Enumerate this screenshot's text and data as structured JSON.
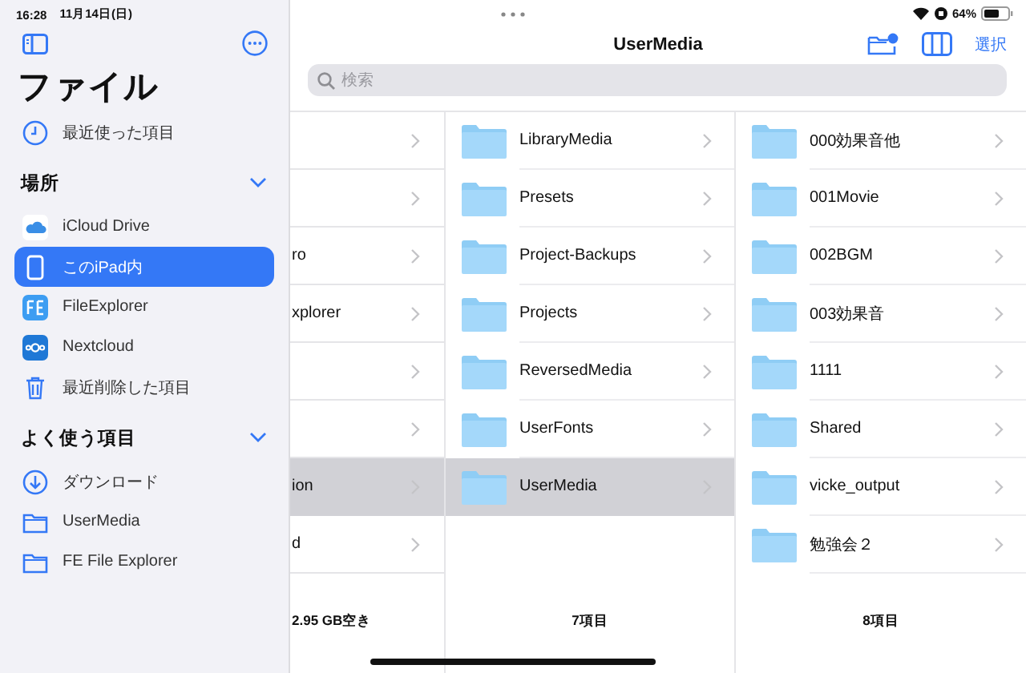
{
  "status_bar": {
    "time": "16:28",
    "date": "11月14日(日)",
    "battery": "64%"
  },
  "sidebar": {
    "title": "ファイル",
    "recents": {
      "label": "最近使った項目"
    },
    "sections": [
      {
        "title": "場所",
        "expanded": true,
        "items": [
          {
            "label": "iCloud Drive",
            "kind": "icloud",
            "selected": false
          },
          {
            "label": "このiPad内",
            "kind": "ipad",
            "selected": true
          },
          {
            "label": "FileExplorer",
            "kind": "fe",
            "selected": false
          },
          {
            "label": "Nextcloud",
            "kind": "nextcloud",
            "selected": false
          },
          {
            "label": "最近削除した項目",
            "kind": "trash",
            "selected": false
          }
        ]
      },
      {
        "title": "よく使う項目",
        "expanded": true,
        "items": [
          {
            "label": "ダウンロード",
            "kind": "download",
            "selected": false
          },
          {
            "label": "UserMedia",
            "kind": "folder",
            "selected": false
          },
          {
            "label": "FE File Explorer",
            "kind": "folder",
            "selected": false
          }
        ]
      }
    ]
  },
  "main": {
    "title": "UserMedia",
    "select_button": "選択",
    "search": {
      "placeholder": "検索"
    },
    "columns": [
      {
        "icons": false,
        "footer": "2.95 GB空き",
        "items": [
          {
            "selected": false
          },
          {
            "selected": false
          },
          {
            "name": "ro",
            "selected": false
          },
          {
            "name": "xplorer",
            "selected": false
          },
          {
            "selected": false
          },
          {
            "selected": false
          },
          {
            "name": "ion",
            "selected": true
          },
          {
            "name": "d",
            "selected": false
          }
        ]
      },
      {
        "icons": true,
        "footer": "7項目",
        "items": [
          {
            "name": "LibraryMedia",
            "selected": false
          },
          {
            "name": "Presets",
            "selected": false
          },
          {
            "name": "Project-Backups",
            "selected": false
          },
          {
            "name": "Projects",
            "selected": false
          },
          {
            "name": "ReversedMedia",
            "selected": false
          },
          {
            "name": "UserFonts",
            "selected": false
          },
          {
            "name": "UserMedia",
            "selected": true
          }
        ]
      },
      {
        "icons": true,
        "footer": "8項目",
        "items": [
          {
            "name": "000効果音他",
            "selected": false
          },
          {
            "name": "001Movie",
            "selected": false
          },
          {
            "name": "002BGM",
            "selected": false
          },
          {
            "name": "003効果音",
            "selected": false
          },
          {
            "name": "1111",
            "selected": false
          },
          {
            "name": "Shared",
            "selected": false
          },
          {
            "name": "vicke_output",
            "selected": false
          },
          {
            "name": "勉強会２",
            "selected": false
          }
        ]
      }
    ]
  }
}
